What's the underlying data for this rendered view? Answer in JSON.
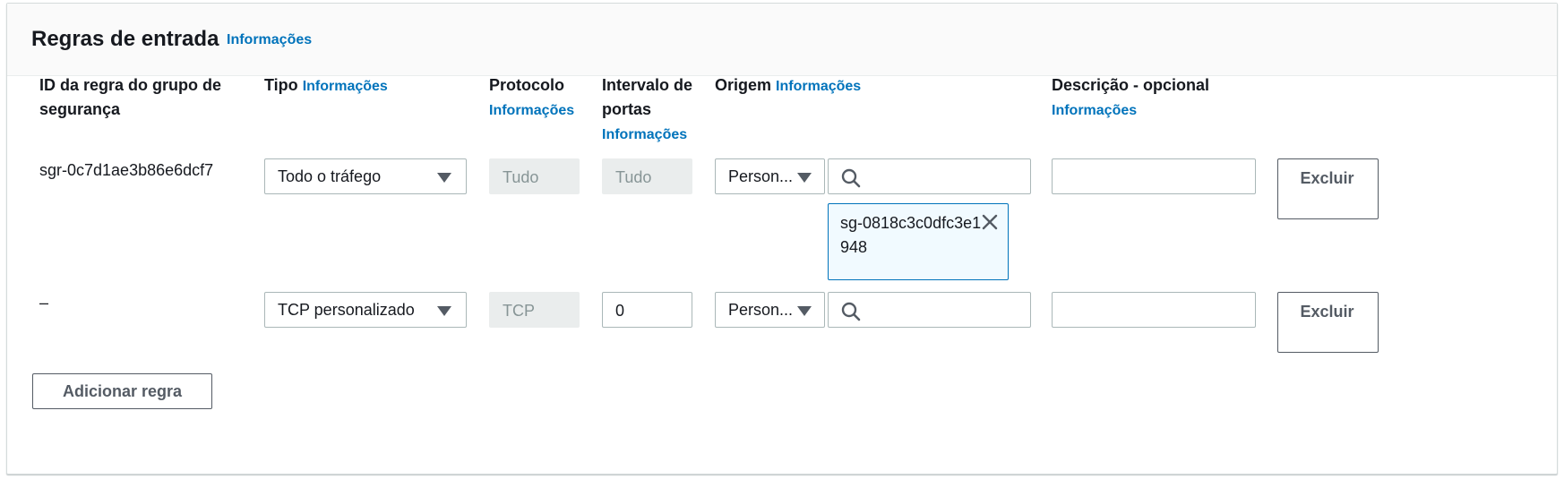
{
  "panel": {
    "title": "Regras de entrada",
    "title_info": "Informações",
    "columns": {
      "rule_id": "ID da regra do grupo de segurança",
      "type": "Tipo",
      "type_info": "Informações",
      "protocol": "Protocolo",
      "protocol_info": "Informações",
      "port_range": "Intervalo de portas",
      "port_range_info": "Informações",
      "source": "Origem",
      "source_info": "Informações",
      "description": "Descrição - opcional",
      "description_info": "Informações"
    },
    "rows": [
      {
        "rule_id": "sgr-0c7d1ae3b86e6dcf7",
        "type": "Todo o tráfego",
        "protocol": "Tudo",
        "port_range": "Tudo",
        "source_select": "Person...",
        "source_search": "",
        "source_token": "sg-0818c3c0dfc3e1948",
        "description": "",
        "delete_label": "Excluir"
      },
      {
        "rule_id": "–",
        "type": "TCP personalizado",
        "protocol": "TCP",
        "port_range": "0",
        "source_select": "Person...",
        "source_search": "",
        "description": "",
        "delete_label": "Excluir"
      }
    ],
    "add_rule_label": "Adicionar regra"
  },
  "colors": {
    "link": "#0073bb",
    "token_border": "#0073bb",
    "token_bg": "#f1faff",
    "disabled_bg": "#eaeded"
  },
  "icons": [
    "search-icon",
    "close-icon",
    "caret-down-icon"
  ]
}
